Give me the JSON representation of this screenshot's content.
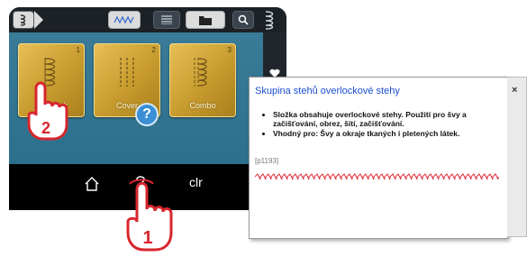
{
  "device": {
    "toolbar": {
      "icons": [
        "stitch-chain-icon",
        "stitch-zigzag-icon",
        "list-icon",
        "folder-icon",
        "search-icon",
        "stitch-pattern-icon"
      ]
    },
    "sidebar": {
      "icons": [
        "heart-icon"
      ]
    },
    "tiles": [
      {
        "number": "1",
        "label": "Overlock"
      },
      {
        "number": "2",
        "label": "Cover"
      },
      {
        "number": "3",
        "label": "Combo"
      }
    ],
    "help_badge": "?",
    "navbar": {
      "home_icon": "home-icon",
      "clr": "clr"
    }
  },
  "popup": {
    "title": "Skupina stehů overlockové stehy",
    "bullets": [
      "Složka obsahuje overlockové stehy. Použití pro švy a začišťování, obrez, šití, začišťování.",
      "Vhodný pro: Švy a okraje tkaných i pletených látek."
    ],
    "ref": "[p1193]",
    "close": "×",
    "stitch_color": "#e0303c"
  },
  "callouts": {
    "step1": "1",
    "step2": "2",
    "color": "#d8262e"
  }
}
